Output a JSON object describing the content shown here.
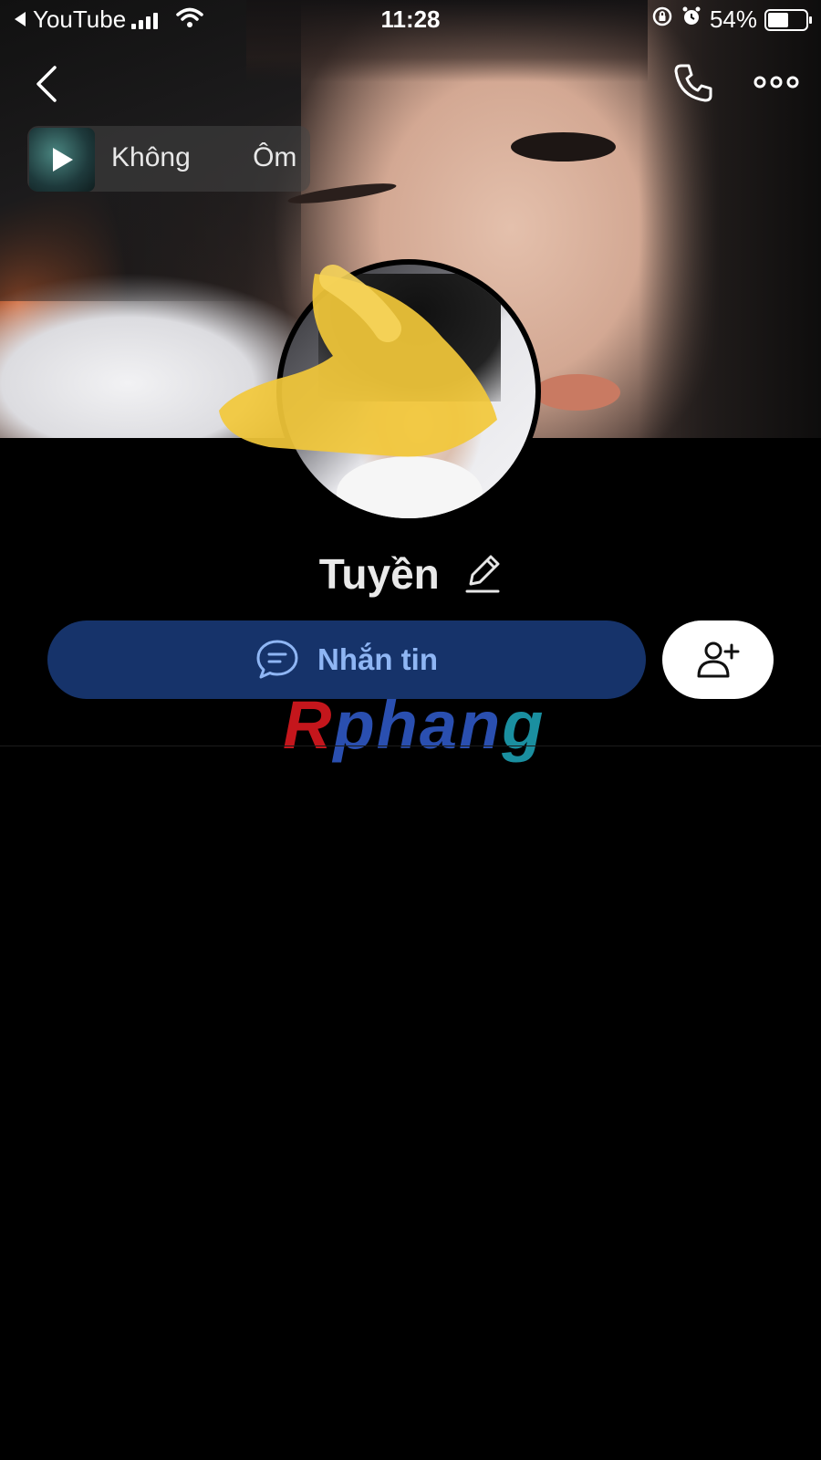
{
  "statusbar": {
    "back_app": "YouTube",
    "time": "11:28",
    "battery": "54%"
  },
  "music": {
    "song_title": "Không Ôm"
  },
  "profile": {
    "name": "Tuyền"
  },
  "actions": {
    "message_label": "Nhắn tin"
  },
  "watermark": {
    "part1": "R",
    "part2": "phan",
    "part3": "g"
  },
  "icons": {
    "back": "chevron-left-icon",
    "call": "phone-icon",
    "more": "more-icon",
    "play": "play-icon",
    "edit": "pencil-icon",
    "chat": "chat-bubble-icon",
    "add_friend": "add-user-icon"
  },
  "colors": {
    "message_button_bg": "#16336a",
    "message_button_text": "#8fb6f4",
    "background": "#000000"
  }
}
